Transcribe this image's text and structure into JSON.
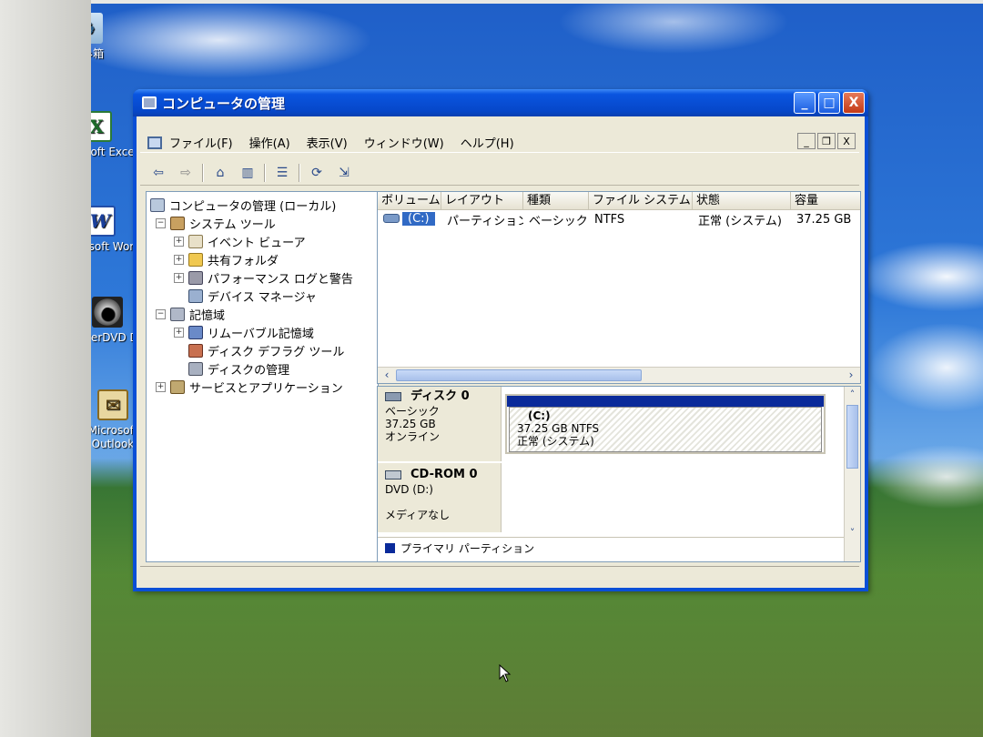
{
  "desktop": {
    "icons": [
      {
        "label": "ごみ箱",
        "icon": "recycle-bin-icon"
      },
      {
        "label": "Microsoft Excel",
        "icon": "excel-icon"
      },
      {
        "label": "Microsoft Word",
        "icon": "word-icon"
      },
      {
        "label": "PowerDVD DX",
        "icon": "powerdvd-icon"
      },
      {
        "label": "Microsoft Outlook",
        "icon": "outlook-icon"
      }
    ]
  },
  "window": {
    "title": "コンピュータの管理",
    "controls": {
      "minimize": "_",
      "maximize": "□",
      "close": "X"
    }
  },
  "menubar": {
    "items": [
      "ファイル(F)",
      "操作(A)",
      "表示(V)",
      "ウィンドウ(W)",
      "ヘルプ(H)"
    ],
    "mdi": {
      "minimize": "_",
      "restore": "❐",
      "close": "X"
    }
  },
  "toolbar": {
    "buttons": [
      "back-icon",
      "forward-icon",
      "up-folder-icon",
      "show-hide-tree-icon",
      "properties-icon",
      "refresh-icon",
      "export-icon"
    ]
  },
  "tree": {
    "root": "コンピュータの管理 (ローカル)",
    "system_tools": "システム ツール",
    "event_viewer": "イベント ビューア",
    "shared_folders": "共有フォルダ",
    "perf_logs": "パフォーマンス ログと警告",
    "device_manager": "デバイス マネージャ",
    "storage": "記憶域",
    "removable": "リムーバブル記憶域",
    "defrag": "ディスク デフラグ ツール",
    "disk_mgmt": "ディスクの管理",
    "services": "サービスとアプリケーション",
    "expanders": {
      "collapsed": "+",
      "expanded": "−"
    }
  },
  "volume_list": {
    "columns": [
      "ボリューム",
      "レイアウト",
      "種類",
      "ファイル システム",
      "状態",
      "容量"
    ],
    "rows": [
      {
        "volume": "(C:)",
        "layout": "パーティション",
        "type": "ベーシック",
        "fs": "NTFS",
        "status": "正常 (システム)",
        "capacity": "37.25 GB"
      }
    ]
  },
  "disk_view": {
    "disk0": {
      "name": "ディスク 0",
      "type": "ベーシック",
      "size": "37.25 GB",
      "state": "オンライン"
    },
    "partition": {
      "name": "(C:)",
      "size_fs": "37.25 GB NTFS",
      "status": "正常 (システム)"
    },
    "cdrom": {
      "name": "CD-ROM 0",
      "drive": "DVD (D:)",
      "media": "メディアなし"
    },
    "legend": "プライマリ パーティション"
  },
  "colors": {
    "title_bar": "#0a55e0",
    "selection": "#316ac5",
    "primary_partition": "#0a2a9a"
  }
}
